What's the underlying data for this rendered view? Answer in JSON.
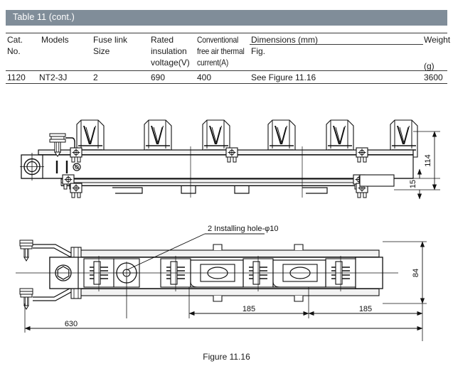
{
  "table": {
    "title": "Table 11 (cont.)",
    "title_bar_color": "#808d99",
    "headers": {
      "cat_no_line1": "Cat.",
      "cat_no_line2": "No.",
      "models": "Models",
      "fuse_link_line1": "Fuse link",
      "fuse_link_line2": "Size",
      "rated_line1": "Rated",
      "rated_line2": "insulation",
      "rated_line3": "voltage(V)",
      "conventional_line1": "Conventional",
      "conventional_line2": "free air thermal",
      "conventional_line3": "current(A)",
      "dimensions": "Dimensions (mm)",
      "dimensions_sub": "Fig.",
      "weight": "Weight",
      "weight_unit": "(g)"
    },
    "rows": [
      {
        "cat_no": "1120",
        "models": "NT2-3J",
        "fuse_link_size": "2",
        "rated_insulation_voltage": "690",
        "conventional_current": "400",
        "dimensions_fig": "See Figure 11.16",
        "weight": "3600"
      }
    ]
  },
  "figure": {
    "caption": "Figure 11.16",
    "annotation_installing_hole": "2 Installing hole-φ10",
    "dimensions": {
      "height_overall": "114",
      "height_base": "15",
      "width_body": "84",
      "pitch_1": "185",
      "pitch_2": "185",
      "overall_length": "630"
    }
  }
}
